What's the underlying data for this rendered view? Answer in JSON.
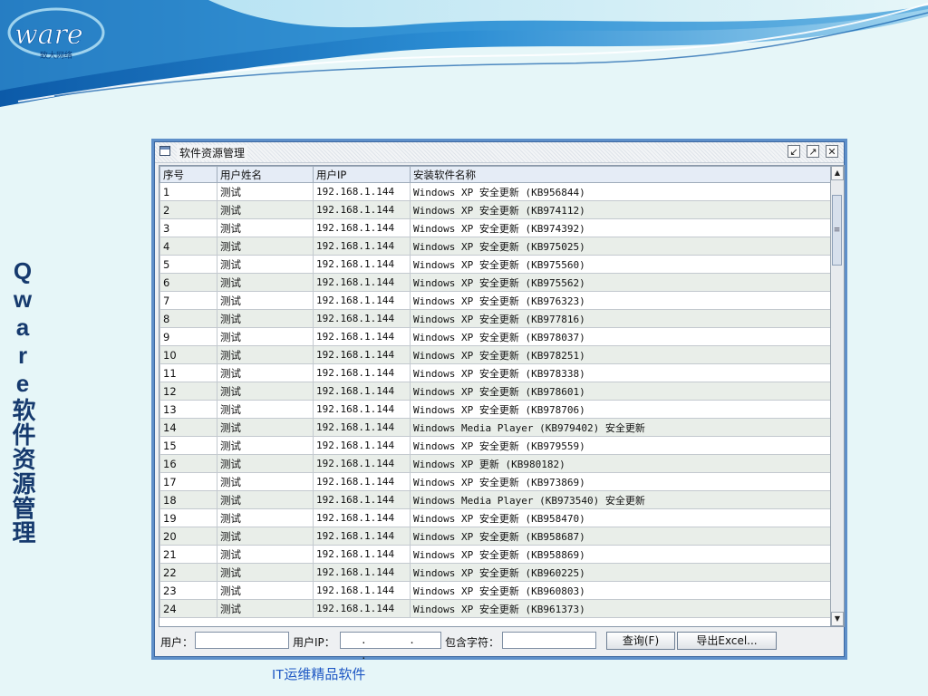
{
  "brand": {
    "logo_text": "ware",
    "logo_subtext": "致大网络"
  },
  "side_title": "Qware软件资源管理",
  "footer": "IT运维精品软件",
  "window": {
    "title": "软件资源管理",
    "controls": [
      "restore-icon",
      "maximize-icon",
      "close-icon"
    ]
  },
  "table": {
    "columns": [
      "序号",
      "用户姓名",
      "用户IP",
      "安装软件名称"
    ],
    "rows": [
      [
        "1",
        "测试",
        "192.168.1.144",
        "Windows XP 安全更新 (KB956844)"
      ],
      [
        "2",
        "测试",
        "192.168.1.144",
        "Windows XP 安全更新 (KB974112)"
      ],
      [
        "3",
        "测试",
        "192.168.1.144",
        "Windows XP 安全更新 (KB974392)"
      ],
      [
        "4",
        "测试",
        "192.168.1.144",
        "Windows XP 安全更新 (KB975025)"
      ],
      [
        "5",
        "测试",
        "192.168.1.144",
        "Windows XP 安全更新 (KB975560)"
      ],
      [
        "6",
        "测试",
        "192.168.1.144",
        "Windows XP 安全更新 (KB975562)"
      ],
      [
        "7",
        "测试",
        "192.168.1.144",
        "Windows XP 安全更新 (KB976323)"
      ],
      [
        "8",
        "测试",
        "192.168.1.144",
        "Windows XP 安全更新 (KB977816)"
      ],
      [
        "9",
        "测试",
        "192.168.1.144",
        "Windows XP 安全更新 (KB978037)"
      ],
      [
        "10",
        "测试",
        "192.168.1.144",
        "Windows XP 安全更新 (KB978251)"
      ],
      [
        "11",
        "测试",
        "192.168.1.144",
        "Windows XP 安全更新 (KB978338)"
      ],
      [
        "12",
        "测试",
        "192.168.1.144",
        "Windows XP 安全更新 (KB978601)"
      ],
      [
        "13",
        "测试",
        "192.168.1.144",
        "Windows XP 安全更新 (KB978706)"
      ],
      [
        "14",
        "测试",
        "192.168.1.144",
        "Windows Media Player (KB979402) 安全更新"
      ],
      [
        "15",
        "测试",
        "192.168.1.144",
        "Windows XP 安全更新 (KB979559)"
      ],
      [
        "16",
        "测试",
        "192.168.1.144",
        "Windows XP 更新 (KB980182)"
      ],
      [
        "17",
        "测试",
        "192.168.1.144",
        "Windows XP 安全更新 (KB973869)"
      ],
      [
        "18",
        "测试",
        "192.168.1.144",
        "Windows Media Player (KB973540) 安全更新"
      ],
      [
        "19",
        "测试",
        "192.168.1.144",
        "Windows XP 安全更新 (KB958470)"
      ],
      [
        "20",
        "测试",
        "192.168.1.144",
        "Windows XP 安全更新 (KB958687)"
      ],
      [
        "21",
        "测试",
        "192.168.1.144",
        "Windows XP 安全更新 (KB958869)"
      ],
      [
        "22",
        "测试",
        "192.168.1.144",
        "Windows XP 安全更新 (KB960225)"
      ],
      [
        "23",
        "测试",
        "192.168.1.144",
        "Windows XP 安全更新 (KB960803)"
      ],
      [
        "24",
        "测试",
        "192.168.1.144",
        "Windows XP 安全更新 (KB961373)"
      ]
    ]
  },
  "filter": {
    "user_label": "用户：",
    "user_value": "",
    "ip_label": "用户IP：",
    "ip_value": ". . .",
    "contains_label": "包含字符：",
    "contains_value": "",
    "query_button": "查询(F)",
    "export_button": "导出Excel..."
  },
  "colors": {
    "window_frame": "#5e8fc9",
    "header_wave": "#1f76c0",
    "title_text": "#163a6e",
    "footer_text": "#1f58c4"
  }
}
